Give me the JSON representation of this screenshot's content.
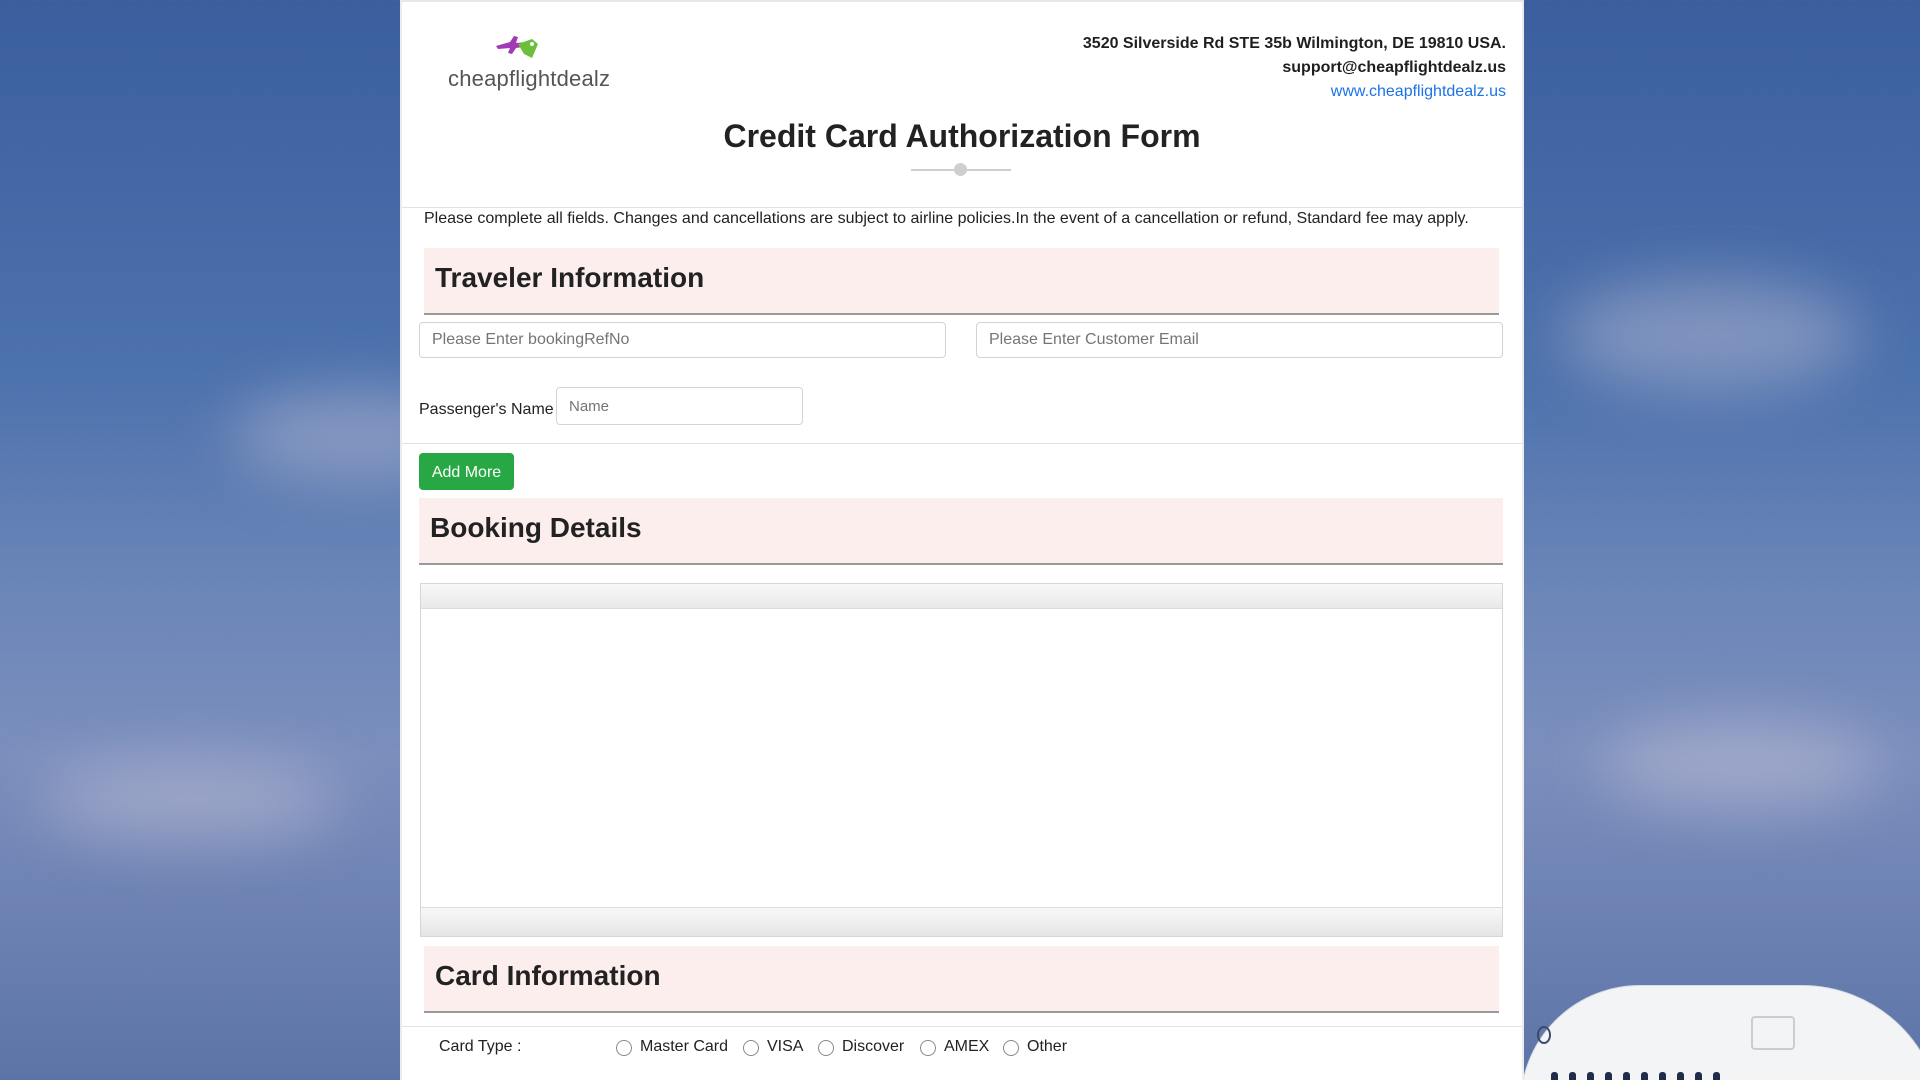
{
  "company": {
    "logo_text": "cheapflightdealz",
    "address": "3520 Silverside Rd STE 35b Wilmington, DE 19810 USA.",
    "email": "support@cheapflightdealz.us",
    "website": "www.cheapflightdealz.us"
  },
  "form": {
    "title": "Credit Card Authorization Form",
    "notice": "Please complete all fields. Changes and cancellations are subject to airline policies.In the event of a cancellation or refund, Standard fee may apply."
  },
  "traveler": {
    "heading": "Traveler Information",
    "booking_ref_placeholder": "Please Enter bookingRefNo",
    "email_placeholder": "Please Enter Customer Email",
    "passenger_label": "Passenger's Name",
    "name_placeholder": "Name",
    "add_more_label": "Add More"
  },
  "booking": {
    "heading": "Booking Details"
  },
  "card": {
    "heading": "Card Information",
    "card_type_label": "Card Type :",
    "options": [
      "Master Card",
      "VISA",
      "Discover",
      "AMEX",
      "Other"
    ]
  },
  "colors": {
    "accent_green": "#28a745",
    "section_bg": "#fdeeee",
    "link_blue": "#1a73e8"
  }
}
